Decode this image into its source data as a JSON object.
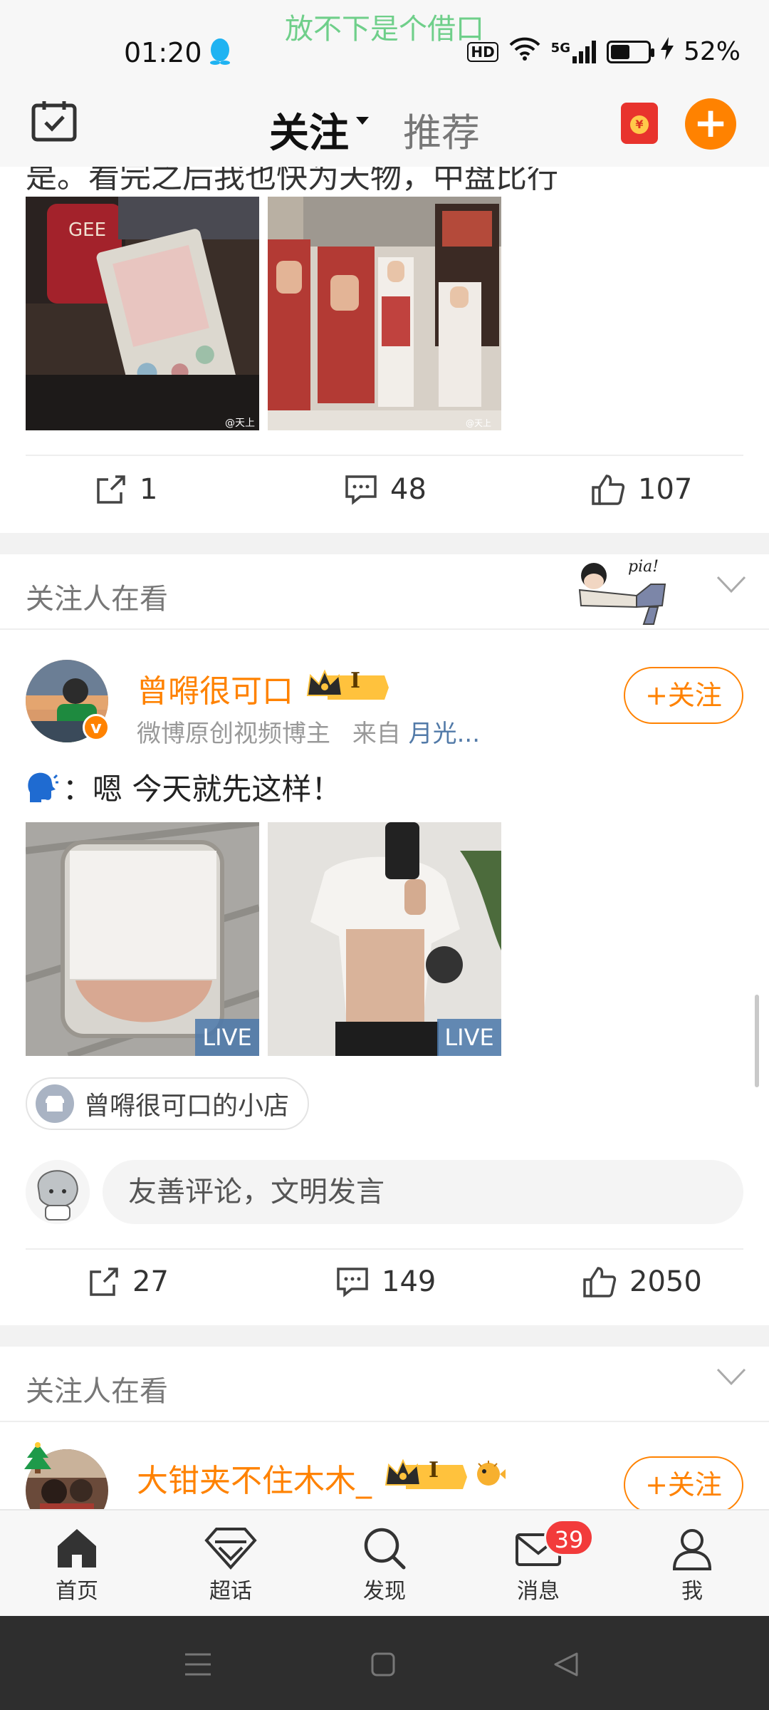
{
  "status_bar": {
    "lyric": "放不下是个借口",
    "time": "01:20",
    "hd": "HD",
    "network": "5G",
    "battery_percent": "52%",
    "battery_level": 0.52
  },
  "top_nav": {
    "tab_follow": "关注",
    "tab_recommend": "推荐"
  },
  "post1": {
    "text_fragment": "是。看完之后我也快为天物，中盘比行",
    "repost_count": "1",
    "comment_count": "48",
    "like_count": "107"
  },
  "strip1": {
    "title": "关注人在看"
  },
  "post2": {
    "username": "曾嘚很可口",
    "level_badge": "I",
    "verified_badge": "v",
    "meta_desc": "微博原创视频博主",
    "meta_from_prefix": "来自",
    "meta_source": "月光...",
    "text": "：嗯 今天就先这样！",
    "follow_label": "+关注",
    "photo_badges": [
      "LIVE",
      "LIVE"
    ],
    "shop_label": "曾嘚很可口的小店",
    "comment_placeholder": "友善评论，文明发言",
    "repost_count": "27",
    "comment_count": "149",
    "like_count": "2050"
  },
  "strip2": {
    "title": "关注人在看"
  },
  "post3": {
    "username": "大钳夹不住木木_",
    "level_badge": "I",
    "follow_label": "+关注"
  },
  "tabbar": {
    "items": [
      {
        "label": "首页",
        "icon": "home-icon"
      },
      {
        "label": "超话",
        "icon": "diamond-icon"
      },
      {
        "label": "发现",
        "icon": "search-icon"
      },
      {
        "label": "消息",
        "icon": "mail-icon",
        "badge": "39"
      },
      {
        "label": "我",
        "icon": "person-icon"
      }
    ]
  },
  "colors": {
    "accent": "#ff8200",
    "badge_red": "#f23b3b",
    "link_blue": "#527aa8"
  }
}
